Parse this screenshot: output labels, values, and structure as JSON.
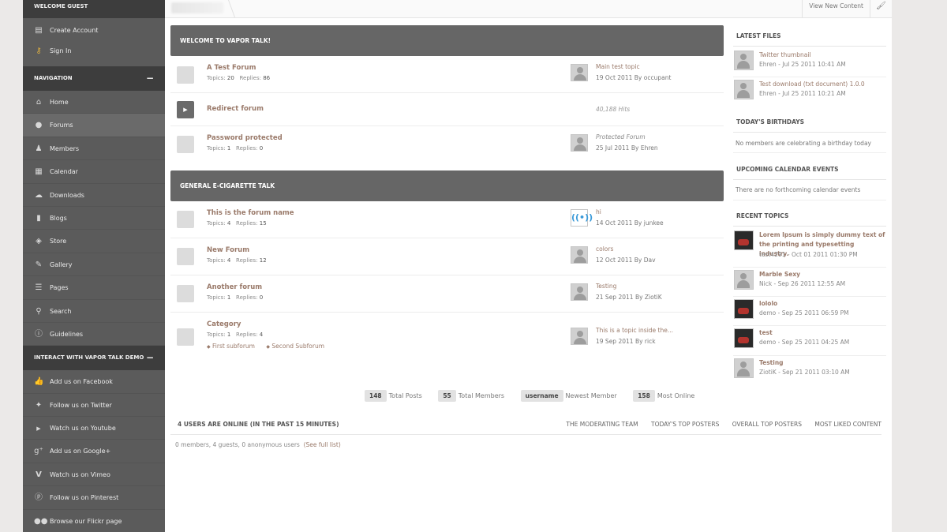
{
  "sidebar": {
    "guest_header": "Welcome Guest",
    "guest_items": [
      {
        "label": "Create Account",
        "icon": "document-icon"
      },
      {
        "label": "Sign In",
        "icon": "key-icon"
      }
    ],
    "nav_header": "Navigation",
    "nav_items": [
      {
        "label": "Home",
        "icon": "home-icon"
      },
      {
        "label": "Forums",
        "icon": "speech-bubble-icon"
      },
      {
        "label": "Members",
        "icon": "user-icon"
      },
      {
        "label": "Calendar",
        "icon": "calendar-icon"
      },
      {
        "label": "Downloads",
        "icon": "cloud-download-icon"
      },
      {
        "label": "Blogs",
        "icon": "book-icon"
      },
      {
        "label": "Store",
        "icon": "tag-icon"
      },
      {
        "label": "Gallery",
        "icon": "brush-icon"
      },
      {
        "label": "Pages",
        "icon": "list-icon"
      },
      {
        "label": "Search",
        "icon": "search-icon"
      },
      {
        "label": "Guidelines",
        "icon": "info-icon"
      }
    ],
    "interact_header": "Interact with Vapor Talk Demo",
    "interact_items": [
      {
        "label": "Add us on Facebook",
        "icon": "thumbs-up-icon"
      },
      {
        "label": "Follow us on Twitter",
        "icon": "twitter-bird-icon"
      },
      {
        "label": "Watch us on Youtube",
        "icon": "youtube-icon"
      },
      {
        "label": "Add us on Google+",
        "icon": "google-plus-icon"
      },
      {
        "label": "Watch us on Vimeo",
        "icon": "vimeo-icon"
      },
      {
        "label": "Follow us on Pinterest",
        "icon": "pinterest-icon"
      },
      {
        "label": "Browse our Flickr page",
        "icon": "flickr-icon"
      }
    ],
    "toggle_symbol": "−"
  },
  "topbar": {
    "view_new": "View New Content",
    "brush_icon": "paintbrush-icon"
  },
  "categories": [
    {
      "title": "Welcome to Vapor Talk!",
      "forums": [
        {
          "name": "A Test Forum",
          "topics": "20",
          "replies": "86",
          "last_title": "Main test topic",
          "last_date": "19 Oct 2011",
          "last_by": "occupant"
        },
        {
          "name": "Redirect forum",
          "hits": "40,188 Hits"
        },
        {
          "name": "Password protected",
          "topics": "1",
          "replies": "0",
          "last_title": "Protected Forum",
          "last_date": "25 Jul 2011",
          "last_by": "Ehren"
        }
      ]
    },
    {
      "title": "General E-Cigarette Talk",
      "forums": [
        {
          "name": "This is the forum name",
          "topics": "4",
          "replies": "15",
          "last_title": "hi",
          "last_date": "14 Oct 2011",
          "last_by": "junkee"
        },
        {
          "name": "New Forum",
          "topics": "4",
          "replies": "12",
          "last_title": "colors",
          "last_date": "12 Oct 2011",
          "last_by": "Dav"
        },
        {
          "name": "Another forum",
          "topics": "1",
          "replies": "0",
          "last_title": "Testing",
          "last_date": "21 Sep 2011",
          "last_by": "ZiotiK"
        },
        {
          "name": "Category",
          "topics": "1",
          "replies": "4",
          "last_title": "This is a topic inside the...",
          "last_date": "19 Sep 2011",
          "last_by": "rick",
          "subforums": [
            "First subforum",
            "Second Subforum"
          ]
        }
      ]
    }
  ],
  "labels": {
    "topics": "Topics:",
    "replies": "Replies:",
    "by": "By",
    "subforum_bullet": "◆"
  },
  "stats": {
    "total_posts_value": "148",
    "total_posts_label": "Total Posts",
    "total_members_value": "55",
    "total_members_label": "Total Members",
    "newest_member_value": "username",
    "newest_member_label": "Newest Member",
    "most_online_value": "158",
    "most_online_label": "Most Online"
  },
  "online": {
    "title": "4 users are online (in the past 15 minutes)",
    "links": [
      "The moderating team",
      "Today's top posters",
      "Overall Top Posters",
      "Most Liked Content"
    ],
    "text": "0 members, 4 guests, 0 anonymous users",
    "see_full": "(See full list)"
  },
  "right": {
    "latest_files_title": "Latest Files",
    "latest_files": [
      {
        "title": "Twitter thumbnail",
        "meta": "Ehren - Jul 25 2011 10:41 AM"
      },
      {
        "title": "Test download (txt document) 1.0.0",
        "meta": "Ehren - Jul 25 2011 10:21 AM"
      }
    ],
    "birthdays_title": "Today's Birthdays",
    "birthdays_text": "No members are celebrating a birthday today",
    "events_title": "Upcoming Calendar Events",
    "events_text": "There are no forthcoming calendar events",
    "recent_title": "Recent Topics",
    "recent": [
      {
        "title": "Lorem Ipsum is simply dummy text of the printing and typesetting industry.",
        "meta": "test4291 - Oct 01 2011 01:30 PM",
        "dark": true
      },
      {
        "title": "Marble Sexy",
        "meta": "Nick - Sep 26 2011 12:55 AM",
        "dark": false
      },
      {
        "title": "lololo",
        "meta": "demo - Sep 25 2011 06:59 PM",
        "dark": true
      },
      {
        "title": "test",
        "meta": "demo - Sep 25 2011 04:25 AM",
        "dark": true
      },
      {
        "title": "Testing",
        "meta": "ZiotiK - Sep 21 2011 03:10 AM",
        "dark": false
      }
    ]
  }
}
